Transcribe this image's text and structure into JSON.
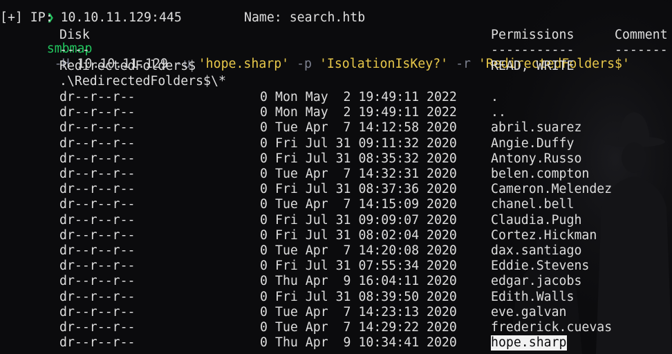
{
  "command": {
    "prompt_symbol": "❯",
    "program": "smbmap",
    "tokens": [
      {
        "text": " ",
        "kind": "plain"
      },
      {
        "text": "-H",
        "kind": "flag"
      },
      {
        "text": " 10.10.11.129 ",
        "kind": "plain"
      },
      {
        "text": "-u",
        "kind": "flag"
      },
      {
        "text": " ",
        "kind": "plain"
      },
      {
        "text": "'hope.sharp'",
        "kind": "string"
      },
      {
        "text": " ",
        "kind": "plain"
      },
      {
        "text": "-p",
        "kind": "flag"
      },
      {
        "text": " ",
        "kind": "plain"
      },
      {
        "text": "'IsolationIsKey?'",
        "kind": "string"
      },
      {
        "text": " ",
        "kind": "plain"
      },
      {
        "text": "-r",
        "kind": "flag"
      },
      {
        "text": " ",
        "kind": "plain"
      },
      {
        "text": "'RedirectedFolders$'",
        "kind": "string"
      }
    ]
  },
  "host_info": {
    "ip_text": "[+] IP: 10.10.11.129:445",
    "name_text": "Name: search.htb"
  },
  "table_header": {
    "disk": "Disk",
    "permissions": "Permissions",
    "comment": "Comment",
    "disk_rule": "----",
    "permissions_rule": "-----------",
    "comment_rule": "-------"
  },
  "share": {
    "name": "RedirectedFolders$",
    "permissions": "READ, WRITE",
    "path": ".\\RedirectedFolders$\\*"
  },
  "entries": [
    {
      "attrs": "dr--r--r--",
      "size": "0",
      "date": "Mon May  2 19:49:11 2022",
      "name": "."
    },
    {
      "attrs": "dr--r--r--",
      "size": "0",
      "date": "Mon May  2 19:49:11 2022",
      "name": ".."
    },
    {
      "attrs": "dr--r--r--",
      "size": "0",
      "date": "Tue Apr  7 14:12:58 2020",
      "name": "abril.suarez"
    },
    {
      "attrs": "dr--r--r--",
      "size": "0",
      "date": "Fri Jul 31 09:11:32 2020",
      "name": "Angie.Duffy"
    },
    {
      "attrs": "dr--r--r--",
      "size": "0",
      "date": "Fri Jul 31 08:35:32 2020",
      "name": "Antony.Russo"
    },
    {
      "attrs": "dr--r--r--",
      "size": "0",
      "date": "Tue Apr  7 14:32:31 2020",
      "name": "belen.compton"
    },
    {
      "attrs": "dr--r--r--",
      "size": "0",
      "date": "Fri Jul 31 08:37:36 2020",
      "name": "Cameron.Melendez"
    },
    {
      "attrs": "dr--r--r--",
      "size": "0",
      "date": "Tue Apr  7 14:15:09 2020",
      "name": "chanel.bell"
    },
    {
      "attrs": "dr--r--r--",
      "size": "0",
      "date": "Fri Jul 31 09:09:07 2020",
      "name": "Claudia.Pugh"
    },
    {
      "attrs": "dr--r--r--",
      "size": "0",
      "date": "Fri Jul 31 08:02:04 2020",
      "name": "Cortez.Hickman"
    },
    {
      "attrs": "dr--r--r--",
      "size": "0",
      "date": "Tue Apr  7 14:20:08 2020",
      "name": "dax.santiago"
    },
    {
      "attrs": "dr--r--r--",
      "size": "0",
      "date": "Fri Jul 31 07:55:34 2020",
      "name": "Eddie.Stevens"
    },
    {
      "attrs": "dr--r--r--",
      "size": "0",
      "date": "Thu Apr  9 16:04:11 2020",
      "name": "edgar.jacobs"
    },
    {
      "attrs": "dr--r--r--",
      "size": "0",
      "date": "Fri Jul 31 08:39:50 2020",
      "name": "Edith.Walls"
    },
    {
      "attrs": "dr--r--r--",
      "size": "0",
      "date": "Tue Apr  7 14:23:13 2020",
      "name": "eve.galvan"
    },
    {
      "attrs": "dr--r--r--",
      "size": "0",
      "date": "Tue Apr  7 14:29:22 2020",
      "name": "frederick.cuevas"
    },
    {
      "attrs": "dr--r--r--",
      "size": "0",
      "date": "Thu Apr  9 10:34:41 2020",
      "name": "hope.sharp",
      "selected": true
    }
  ],
  "colors": {
    "background": "#0b0b0d",
    "text": "#dedede",
    "prompt": "#22c55e",
    "flag": "#7d8190",
    "string": "#e8c84a",
    "selection_bg": "#f2f2f2"
  }
}
